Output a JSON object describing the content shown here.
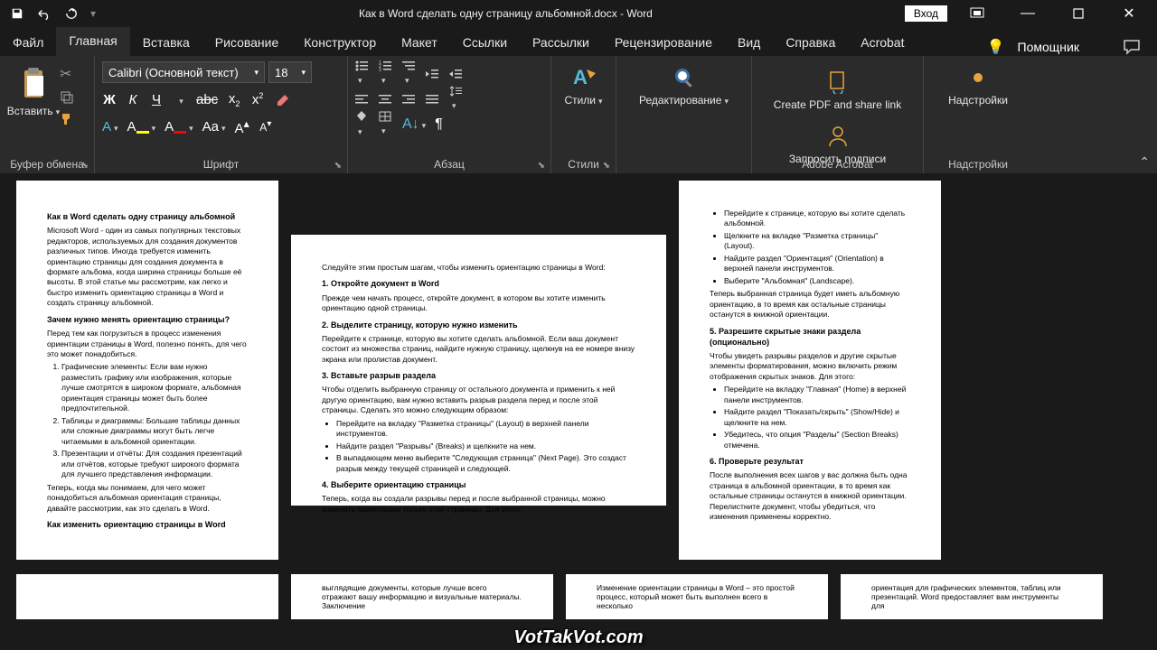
{
  "title": "Как в Word сделать одну страницу альбомной.docx  -  Word",
  "login": "Вход",
  "tabs": [
    "Файл",
    "Главная",
    "Вставка",
    "Рисование",
    "Конструктор",
    "Макет",
    "Ссылки",
    "Рассылки",
    "Рецензирование",
    "Вид",
    "Справка",
    "Acrobat"
  ],
  "helper": "Помощник",
  "ribbon": {
    "clipboard": {
      "label": "Буфер обмена",
      "paste": "Вставить"
    },
    "font": {
      "label": "Шрифт",
      "name": "Calibri (Основной текст)",
      "size": "18"
    },
    "para": {
      "label": "Абзац"
    },
    "styles": {
      "label": "Стили",
      "btn": "Стили"
    },
    "editing": {
      "btn": "Редактирование"
    },
    "acrobat": {
      "label": "Adobe Acrobat",
      "pdf": "Create PDF and share link",
      "sign": "Запросить подписи"
    },
    "addins": {
      "label": "Надстройки",
      "btn": "Надстройки"
    }
  },
  "doc": {
    "p1": {
      "title": "Как в Word сделать одну страницу альбомной",
      "intro": "Microsoft Word - один из самых популярных текстовых редакторов, используемых для создания документов различных типов. Иногда требуется изменить ориентацию страницы для создания документа в формате альбома, когда ширина страницы больше её высоты. В этой статье мы рассмотрим, как легко и быстро изменить ориентацию страницы в Word и создать страницу альбомной.",
      "h2": "Зачем нужно менять ориентацию страницы?",
      "p2": "Перед тем как погрузиться в процесс изменения ориентации страницы в Word, полезно понять, для чего это может понадобиться.",
      "li1": "Графические элементы: Если вам нужно разместить графику или изображения, которые лучше смотрятся в широком формате, альбомная ориентация страницы может быть более предпочтительной.",
      "li2": "Таблицы и диаграммы: Большие таблицы данных или сложные диаграммы могут быть легче читаемыми в альбомной ориентации.",
      "li3": "Презентации и отчёты: Для создания презентаций или отчётов, которые требуют широкого формата для лучшего представления информации.",
      "p3": "Теперь, когда мы понимаем, для чего может понадобиться альбомная ориентация страницы, давайте рассмотрим, как это сделать в Word.",
      "h3": "Как изменить ориентацию страницы в Word"
    },
    "p2": {
      "l1": "Следуйте этим простым шагам, чтобы изменить ориентацию страницы в Word:",
      "h1": "1. Откройте документ в Word",
      "p1": "Прежде чем начать процесс, откройте документ, в котором вы хотите изменить ориентацию одной страницы.",
      "h2": "2. Выделите страницу, которую нужно изменить",
      "p2": "Перейдите к странице, которую вы хотите сделать альбомной. Если ваш документ состоит из множества страниц, найдите нужную страницу, щелкнув на ее номере внизу экрана или пролистав документ.",
      "h3": "3. Вставьте разрыв раздела",
      "p3": "Чтобы отделить выбранную страницу от остального документа и применить к ней другую ориентацию, вам нужно вставить разрыв раздела перед и после этой страницы. Сделать это можно следующим образом:",
      "li1": "Перейдите на вкладку \"Разметка страницы\" (Layout) в верхней панели инструментов.",
      "li2": "Найдите раздел \"Разрывы\" (Breaks) и щелкните на нем.",
      "li3": "В выпадающем меню выберите \"Следующая страница\" (Next Page). Это создаст разрыв между текущей страницей и следующей.",
      "h4": "4. Выберите ориентацию страницы",
      "p4": "Теперь, когда вы создали разрывы перед и после выбранной страницы, можно изменить ориентацию только этой страницы. Для этого:"
    },
    "p3": {
      "li1": "Перейдите к странице, которую вы хотите сделать альбомной.",
      "li2": "Щелкните на вкладке \"Разметка страницы\" (Layout).",
      "li3": "Найдите раздел \"Ориентация\" (Orientation) в верхней панели инструментов.",
      "li4": "Выберите \"Альбомная\" (Landscape).",
      "p1": "Теперь выбранная страница будет иметь альбомную ориентацию, в то время как остальные страницы останутся в книжной ориентации.",
      "h1": "5. Разрешите скрытые знаки раздела (опционально)",
      "p2": "Чтобы увидеть разрывы разделов и другие скрытые элементы форматирования, можно включить режим отображения скрытых знаков. Для этого:",
      "li5": "Перейдите на вкладку \"Главная\" (Home) в верхней панели инструментов.",
      "li6": "Найдите раздел \"Показать/скрыть\" (Show/Hide) и щелкните на нем.",
      "li7": "Убедитесь, что опция \"Разделы\" (Section Breaks) отмечена.",
      "h2": "6. Проверьте результат",
      "p3": "После выполнения всех шагов у вас должна быть одна страница в альбомной ориентации, в то время как остальные страницы останутся в книжной ориентации. Перелистните документ, чтобы убедиться, что изменения применены корректно."
    },
    "stub2": "выглядящие документы, которые лучше всего отражают вашу информацию и визуальные материалы. Заключение",
    "stub3": "Изменение ориентации страницы в Word – это простой процесс, который может быть выполнен всего в несколько",
    "stub4": "ориентация для графических элементов, таблиц или презентаций. Word предоставляет вам инструменты для"
  },
  "watermark": "VotTakVot.com"
}
